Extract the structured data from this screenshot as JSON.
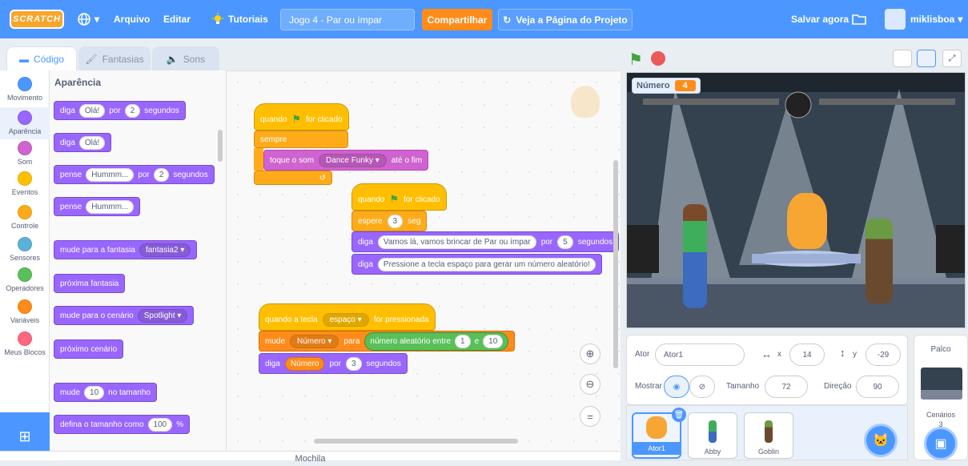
{
  "menubar": {
    "logo": "SCRATCH",
    "language_caret": "▾",
    "file": "Arquivo",
    "edit": "Editar",
    "tutorials": "Tutoriais",
    "project_title": "Jogo 4 - Par ou ímpar",
    "share": "Compartilhar",
    "see_project": "Veja a Página do Projeto",
    "save_now": "Salvar agora",
    "username": "miklisboa"
  },
  "tabs": {
    "code": "Código",
    "costumes": "Fantasias",
    "sounds": "Sons"
  },
  "categories": [
    {
      "label": "Movimento",
      "color": "#4c97ff"
    },
    {
      "label": "Aparência",
      "color": "#9966ff"
    },
    {
      "label": "Som",
      "color": "#cf63cf"
    },
    {
      "label": "Eventos",
      "color": "#ffbf00"
    },
    {
      "label": "Controle",
      "color": "#ffab19"
    },
    {
      "label": "Sensores",
      "color": "#5cb1d6"
    },
    {
      "label": "Operadores",
      "color": "#59c059"
    },
    {
      "label": "Variáveis",
      "color": "#ff8c1a"
    },
    {
      "label": "Meus Blocos",
      "color": "#ff6680"
    }
  ],
  "palette": {
    "title": "Aparência",
    "say_secs": {
      "op": "diga",
      "msg": "Olá!",
      "por": "por",
      "secs": "2",
      "unit": "segundos"
    },
    "say": {
      "op": "diga",
      "msg": "Olá!"
    },
    "think_secs": {
      "op": "pense",
      "msg": "Hummm...",
      "por": "por",
      "secs": "2",
      "unit": "segundos"
    },
    "think": {
      "op": "pense",
      "msg": "Hummm..."
    },
    "switch_costume": {
      "op": "mude para a fantasia",
      "value": "fantasia2"
    },
    "next_costume": "próxima fantasia",
    "switch_backdrop": {
      "op": "mude para o cenário",
      "value": "Spotlight"
    },
    "next_backdrop": "próximo cenário",
    "change_size": {
      "op": "mude",
      "value": "10",
      "suffix": "no tamanho"
    },
    "set_size": {
      "op": "defina o tamanho como",
      "value": "100",
      "suffix": "%"
    }
  },
  "script1": {
    "hat": "quando",
    "hat2": "for clicado",
    "forever": "sempre",
    "sound_pre": "toque o som",
    "sound": "Dance Funky",
    "sound_post": "até o fim"
  },
  "script2": {
    "hat": "quando",
    "hat2": "for clicado",
    "wait": "espere",
    "wait_val": "3",
    "wait_unit": "seg",
    "say1": "diga",
    "say1_msg": "Vamos lá, vamos brincar de Par ou ímpar",
    "say1_por": "por",
    "say1_secs": "5",
    "say1_unit": "segundos",
    "say2": "diga",
    "say2_msg": "Pressione a tecla espaço para gerar um número aleatório!"
  },
  "script3": {
    "hat": "quando a tecla",
    "key": "espaço",
    "hat2": "for pressionada",
    "set": "mude",
    "var": "Número",
    "para": "para",
    "rand": "número aleatório entre",
    "from": "1",
    "e": "e",
    "to": "10",
    "say": "diga",
    "say_var": "Número",
    "por": "por",
    "secs": "3",
    "unit": "segundos"
  },
  "mochila": "Mochila",
  "stage": {
    "monitor_label": "Número",
    "monitor_value": "4"
  },
  "sprite_info": {
    "actor_label": "Ator",
    "actor_name": "Ator1",
    "x_label": "x",
    "x": "14",
    "y_label": "y",
    "y": "-29",
    "show_label": "Mostrar",
    "size_label": "Tamanho",
    "size": "72",
    "dir_label": "Direção",
    "dir": "90"
  },
  "sprites": [
    "Ator1",
    "Abby",
    "Goblin"
  ],
  "palco": {
    "title": "Palco",
    "backdrops_label": "Cenários",
    "backdrops_count": "3"
  },
  "colors": {
    "accent": "#4c97ff",
    "looks": "#9966ff",
    "events": "#ffbf00",
    "control": "#ffab19",
    "sound": "#cf63cf",
    "variables": "#ff8c1a",
    "operators": "#59c059"
  }
}
